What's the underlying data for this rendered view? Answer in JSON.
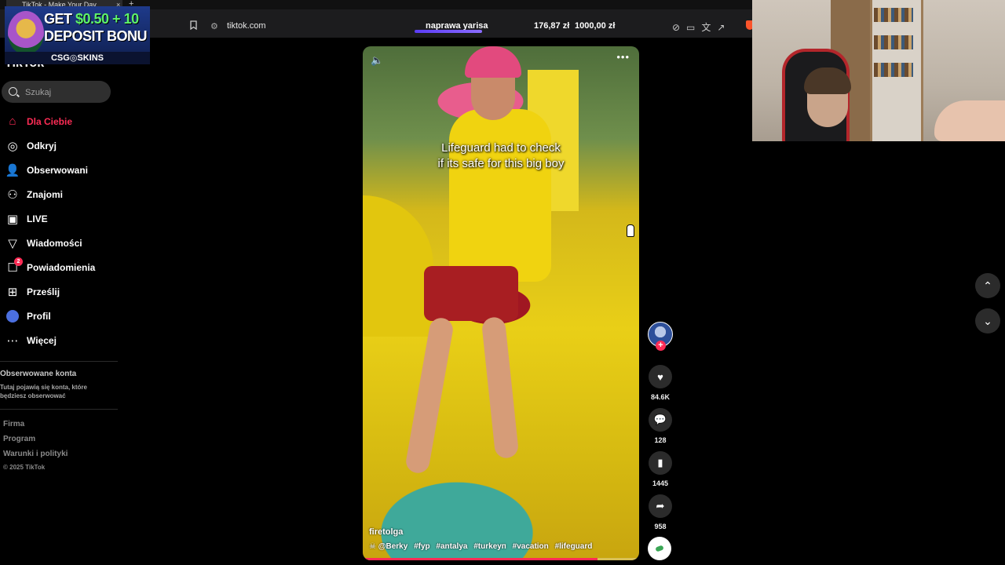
{
  "browser": {
    "tab_title": "TikTok - Make Your Day",
    "tab_close": "×",
    "new_tab": "+",
    "url": "tiktok.com",
    "extension_label": "naprawa yarisa",
    "balance_1": "176,87 zł",
    "balance_2": "1000,00 zł"
  },
  "ad": {
    "line1_prefix": "GET ",
    "line1_money": "$0.50 + 10",
    "line2": "DEPOSIT BONU",
    "brand": "CSG◎SKINS"
  },
  "sidebar": {
    "logo": "TikTok",
    "search_placeholder": "Szukaj",
    "items": [
      {
        "label": "Dla Ciebie",
        "icon": "home-icon",
        "active": true
      },
      {
        "label": "Odkryj",
        "icon": "compass-icon"
      },
      {
        "label": "Obserwowani",
        "icon": "user-follow-icon"
      },
      {
        "label": "Znajomi",
        "icon": "friends-icon"
      },
      {
        "label": "LIVE",
        "icon": "live-icon"
      },
      {
        "label": "Wiadomości",
        "icon": "messages-icon"
      },
      {
        "label": "Powiadomienia",
        "icon": "notifications-icon",
        "badge": "2"
      },
      {
        "label": "Prześlij",
        "icon": "upload-icon"
      },
      {
        "label": "Profil",
        "icon": "profile-icon"
      },
      {
        "label": "Więcej",
        "icon": "more-icon"
      }
    ],
    "followed_title": "Obserwowane konta",
    "followed_text": "Tutaj pojawią się konta, które będziesz obserwować",
    "footer": [
      "Firma",
      "Program",
      "Warunki i polityki"
    ],
    "copyright": "© 2025 TikTok"
  },
  "video": {
    "caption_line1": "Lifeguard had to check",
    "caption_line2": "if its safe for this big boy",
    "author": "firetolga",
    "mention": "☠ @Berky",
    "hashtags": [
      "#fyp",
      "#antalya",
      "#turkeyп",
      "#vacation",
      "#lifeguard"
    ],
    "progress_fraction": 0.85
  },
  "actions": {
    "likes": "84.6K",
    "comments": "128",
    "bookmarks": "1445",
    "shares": "958"
  },
  "colors": {
    "accent": "#fe2c55",
    "background": "#000000"
  }
}
